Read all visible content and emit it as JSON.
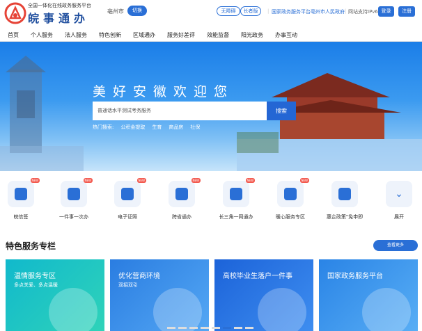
{
  "header": {
    "logo_subtitle": "全国一体化在线政务服务平台",
    "logo_title": "皖事通办",
    "city": "亳州市",
    "switch_label": "切换",
    "elder_mode": "无障碍",
    "assist_mode": "长者版",
    "links": [
      "国家政务服务平台",
      "亳州市人民政府"
    ],
    "ipv6": "网站支持IPv6",
    "login": "登录",
    "register": "注册"
  },
  "nav": {
    "items": [
      "首页",
      "个人服务",
      "法人服务",
      "特色创新",
      "区域通办",
      "服务好差评",
      "效能监督",
      "阳光政务",
      "办事互动"
    ]
  },
  "banner": {
    "title": "美好安徽欢迎您",
    "search_placeholder": "普通话水平测试考务服务",
    "search_button": "搜索",
    "hot_label": "热门搜索:",
    "hot_items": [
      "公积金提取",
      "生育",
      "商品房",
      "社保"
    ]
  },
  "services": [
    {
      "label": "皖信签",
      "new": "NEW",
      "icon": "person-icon"
    },
    {
      "label": "一件事一次办",
      "new": "NEW",
      "icon": "grid-icon"
    },
    {
      "label": "电子证照",
      "new": "NEW",
      "icon": "document-icon"
    },
    {
      "label": "跨省通办",
      "new": "NEW",
      "icon": "monitor-icon"
    },
    {
      "label": "长三角一网通办",
      "new": "NEW",
      "icon": "monitor-icon"
    },
    {
      "label": "暖心服务专区",
      "new": "NEW",
      "icon": "cube-icon"
    },
    {
      "label": "惠企政策\"免申即",
      "new": "",
      "icon": "clipboard-icon"
    },
    {
      "label": "展开",
      "new": "",
      "icon": "chevron-down-icon"
    }
  ],
  "featured": {
    "title": "特色服务专栏",
    "more": "查看更多",
    "cards": [
      {
        "title": "温情服务专区",
        "sub": "多点关爱、多点温暖",
        "color": "#15b7c9"
      },
      {
        "title": "优化营商环境",
        "sub": "双招双引",
        "color": "#2a7de1"
      },
      {
        "title": "高校毕业生落户一件事",
        "sub": "",
        "color": "#1e6ee0"
      },
      {
        "title": "国家政务服务平台",
        "sub": "",
        "color": "#2a84e6"
      }
    ]
  }
}
